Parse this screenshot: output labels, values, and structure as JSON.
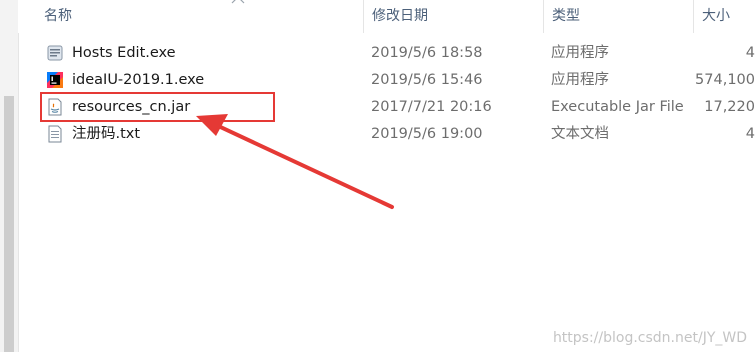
{
  "columns": {
    "name": "名称",
    "date": "修改日期",
    "type": "类型",
    "size": "大小"
  },
  "files": [
    {
      "name": "Hosts Edit.exe",
      "date": "2019/5/6 18:58",
      "type": "应用程序",
      "size": "4",
      "icon": "hosts-edit-icon"
    },
    {
      "name": "ideaIU-2019.1.exe",
      "date": "2019/5/6 15:46",
      "type": "应用程序",
      "size": "574,100",
      "icon": "intellij-idea-icon"
    },
    {
      "name": "resources_cn.jar",
      "date": "2017/7/21 20:16",
      "type": "Executable Jar File",
      "size": "17,220",
      "icon": "java-jar-icon"
    },
    {
      "name": "注册码.txt",
      "date": "2019/5/6 19:00",
      "type": "文本文档",
      "size": "4",
      "icon": "text-file-icon"
    }
  ],
  "annotation": {
    "highlight_color": "#e53935"
  },
  "watermark": "https://blog.csdn.net/JY_WD"
}
